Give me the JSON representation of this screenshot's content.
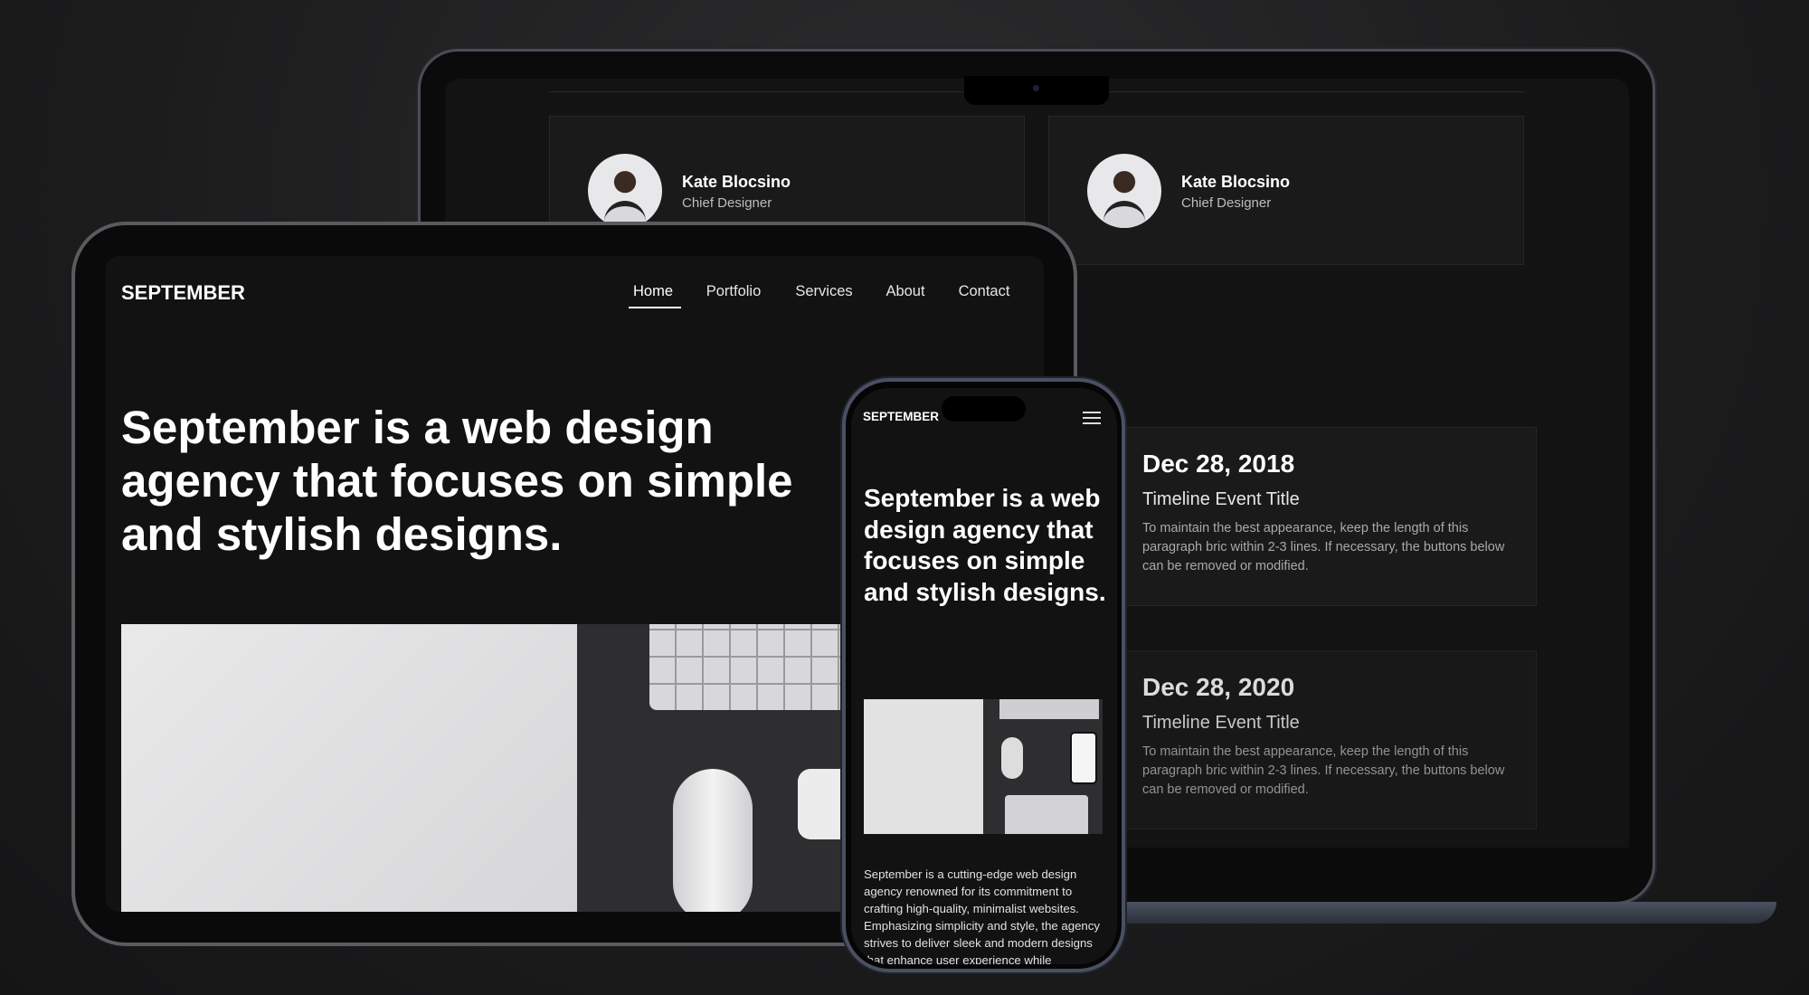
{
  "laptop": {
    "profiles": [
      {
        "name": "Kate Blocsino",
        "role": "Chief Designer"
      },
      {
        "name": "Kate Blocsino",
        "role": "Chief Designer"
      }
    ],
    "timeline": [
      {
        "date": "Dec 28, 2018",
        "title": "Timeline Event Title",
        "description": "To maintain the best appearance, keep the length of this paragraph bric within 2-3 lines. If necessary, the buttons below can be removed or modified."
      },
      {
        "date": "Dec 28, 2020",
        "title": "Timeline Event Title",
        "description": "To maintain the best appearance, keep the length of this paragraph bric within 2-3 lines. If necessary, the buttons below can be removed or modified."
      }
    ]
  },
  "tablet": {
    "logo": "SEPTEMBER",
    "nav": [
      {
        "label": "Home",
        "active": true
      },
      {
        "label": "Portfolio"
      },
      {
        "label": "Services"
      },
      {
        "label": "About"
      },
      {
        "label": "Contact"
      }
    ],
    "hero": "September is a web design agency that focuses on simple and stylish designs."
  },
  "phone": {
    "logo": "SEPTEMBER",
    "menu_icon": "hamburger-icon",
    "hero": "September is a web design agency that focuses on simple and stylish designs.",
    "paragraph": "September is a cutting-edge web design agency renowned for its commitment to crafting high-quality, minimalist websites. Emphasizing simplicity and style, the agency strives to deliver sleek and modern designs that enhance user experience while"
  }
}
